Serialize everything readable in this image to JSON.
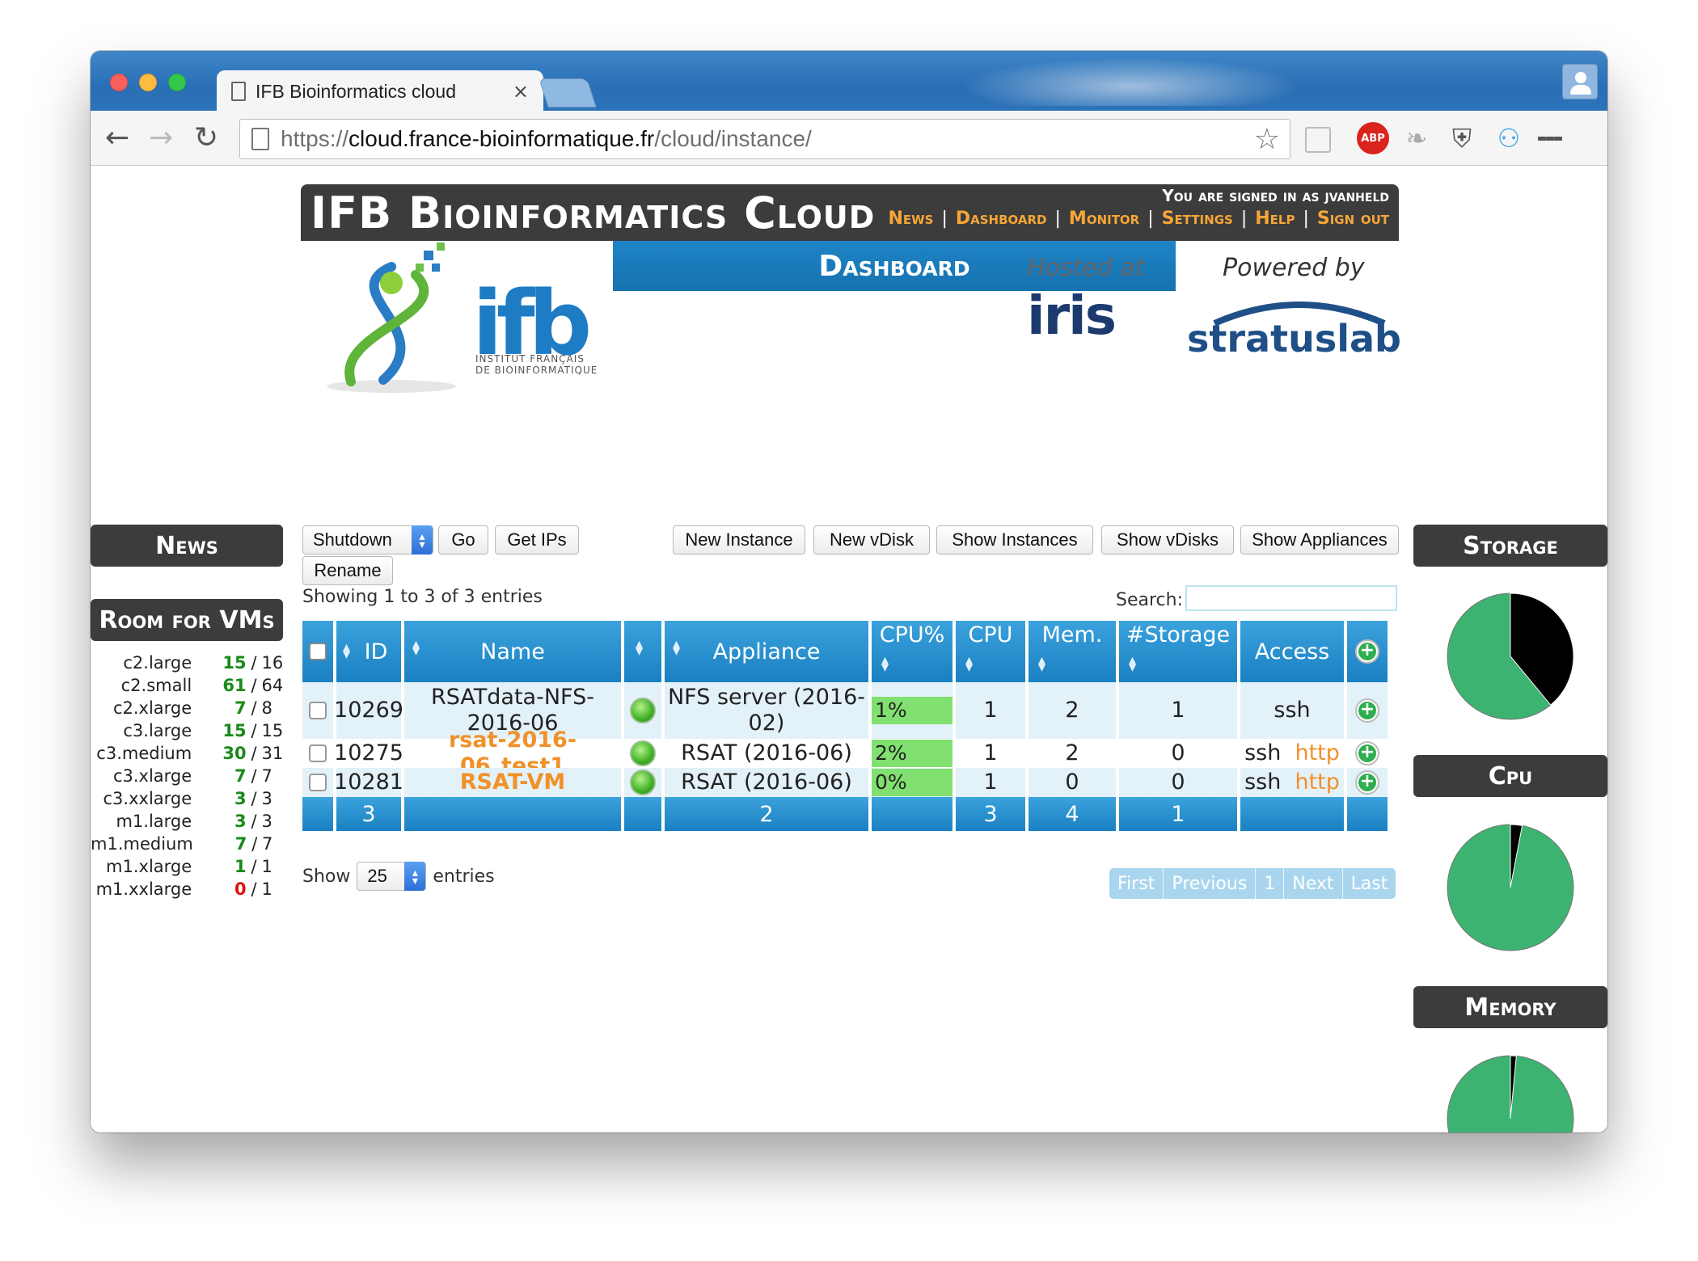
{
  "browser": {
    "tab_title": "IFB Bioinformatics cloud",
    "tab_close": "×",
    "url_scheme": "https://",
    "url_host": "cloud.france-bioinformatique.fr",
    "url_path": "/cloud/instance/",
    "ext_abp": "ABP"
  },
  "header": {
    "site_title": "IFB Bioinformatics Cloud",
    "signed_in": "You are signed in as jvanheld",
    "nav": [
      "News",
      "Dashboard",
      "Monitor",
      "Settings",
      "Help",
      "Sign out"
    ],
    "sep": "|",
    "dashboard_tab": "Dashboard"
  },
  "logos": {
    "ifb_big": "ifb",
    "ifb_line1": "INSTITUT FRANÇAIS",
    "ifb_line2": "DE BIOINFORMATIQUE",
    "hosted_at": "Hosted at",
    "iris": "iris",
    "powered_by": "Powered by",
    "stratuslab": "stratuslab"
  },
  "left": {
    "news_title": "News",
    "room_title": "Room for VMs",
    "rooms": [
      {
        "type": "c2.large",
        "free": "15",
        "total": "16",
        "color": "#1a8a1a"
      },
      {
        "type": "c2.small",
        "free": "61",
        "total": "64",
        "color": "#1a8a1a"
      },
      {
        "type": "c2.xlarge",
        "free": "7",
        "total": "8",
        "color": "#1a8a1a"
      },
      {
        "type": "c3.large",
        "free": "15",
        "total": "15",
        "color": "#1a8a1a"
      },
      {
        "type": "c3.medium",
        "free": "30",
        "total": "31",
        "color": "#1a8a1a"
      },
      {
        "type": "c3.xlarge",
        "free": "7",
        "total": "7",
        "color": "#1a8a1a"
      },
      {
        "type": "c3.xxlarge",
        "free": "3",
        "total": "3",
        "color": "#1a8a1a"
      },
      {
        "type": "m1.large",
        "free": "3",
        "total": "3",
        "color": "#1a8a1a"
      },
      {
        "type": "m1.medium",
        "free": "7",
        "total": "7",
        "color": "#1a8a1a"
      },
      {
        "type": "m1.xlarge",
        "free": "1",
        "total": "1",
        "color": "#1a8a1a"
      },
      {
        "type": "m1.xxlarge",
        "free": "0",
        "total": "1",
        "color": "#e01010"
      }
    ],
    "slash": "/"
  },
  "controls": {
    "action_select": "Shutdown",
    "go": "Go",
    "get_ips": "Get IPs",
    "rename": "Rename",
    "new_instance": "New Instance",
    "new_vdisk": "New vDisk",
    "show_instances": "Show Instances",
    "show_vdisks": "Show vDisks",
    "show_appliances": "Show Appliances",
    "showing": "Showing 1 to 3 of 3 entries",
    "search_label": "Search:",
    "search_value": "",
    "show": "Show",
    "page_size": "25",
    "entries": "entries"
  },
  "table": {
    "headers": {
      "id": "ID",
      "name": "Name",
      "appliance": "Appliance",
      "cpu_pct": "CPU%",
      "cpu": "CPU",
      "mem": "Mem.",
      "storage": "#Storage",
      "access": "Access"
    },
    "rows": [
      {
        "id": "10269",
        "name": "RSATdata-NFS-2016-06",
        "appliance": "NFS server (2016-02)",
        "cpu_pct": "1%",
        "cpu_level": 1,
        "cpu": "1",
        "mem": "2",
        "storage": "1",
        "ssh": "ssh",
        "http": ""
      },
      {
        "id": "10275",
        "name": "rsat-2016-06_test1",
        "appliance": "RSAT (2016-06)",
        "cpu_pct": "2%",
        "cpu_level": 2,
        "cpu": "1",
        "mem": "2",
        "storage": "0",
        "ssh": "ssh",
        "http": "http"
      },
      {
        "id": "10281",
        "name": "RSAT-VM",
        "appliance": "RSAT (2016-06)",
        "cpu_pct": "0%",
        "cpu_level": 0,
        "cpu": "1",
        "mem": "0",
        "storage": "0",
        "ssh": "ssh",
        "http": "http"
      }
    ],
    "totals": {
      "id": "3",
      "appliance": "2",
      "cpu": "3",
      "mem": "4",
      "storage": "1"
    }
  },
  "pager": [
    "First",
    "Previous",
    "1",
    "Next",
    "Last"
  ],
  "right": {
    "storage_title": "Storage",
    "cpu_title": "Cpu",
    "memory_title": "Memory",
    "storage_used_fraction": 0.39,
    "cpu_used_fraction": 0.03,
    "memory_used_fraction": 0.015,
    "free_color": "#3cb371",
    "used_color": "#000000"
  }
}
